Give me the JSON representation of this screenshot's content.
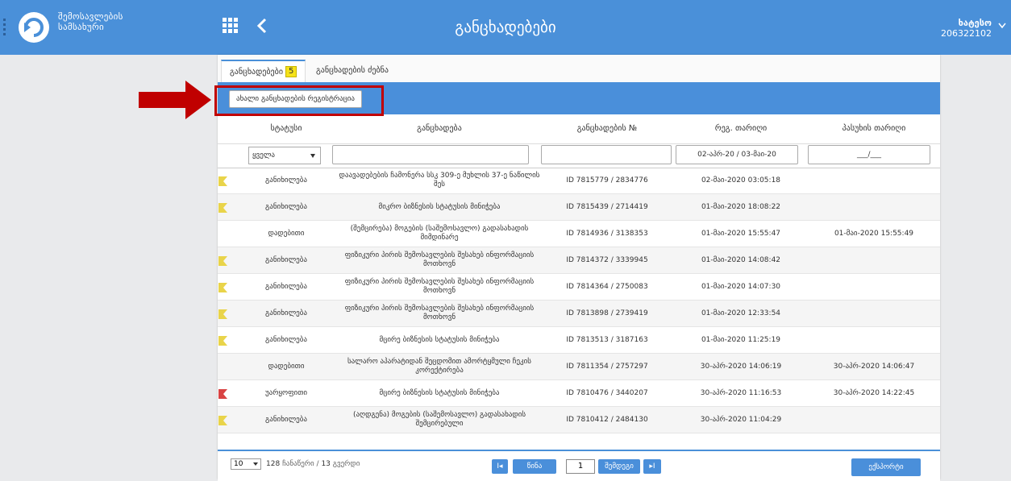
{
  "header": {
    "org_line1": "შემოსავლების",
    "org_line2": "სამსახური",
    "title": "განცხადებები",
    "user_name": "ხატესო",
    "user_id": "206322102"
  },
  "tabs": [
    {
      "label": "განცხადებები",
      "badge": "5"
    },
    {
      "label": "განცხადების ძებნა"
    }
  ],
  "toolbar": {
    "new_button": "ახალი განცხადების რეგისტრაცია"
  },
  "columns": [
    "სტატუსი",
    "განცხადება",
    "განცხადების №",
    "რეგ. თარიღი",
    "პასუხის თარიღი"
  ],
  "filters": {
    "status_value": "ყველა",
    "date_range": "02-აპრ-20 / 03-მაი-20",
    "answer_date": "___/___"
  },
  "rows": [
    {
      "flag": "yellow",
      "status": "განიხილება",
      "app": "დაავადებების ჩამონერა სსკ 309-ე მუხლის 37-ე ნაწილის შეს",
      "no": "ID 7815779 / 2834776",
      "reg": "02-მაი-2020 03:05:18",
      "ans": ""
    },
    {
      "flag": "yellow",
      "status": "განიხილება",
      "app": "მიკრო ბიზნესის სტატუსის მინიჭება",
      "no": "ID 7815439 / 2714419",
      "reg": "01-მაი-2020 18:08:22",
      "ans": ""
    },
    {
      "flag": "",
      "status": "დადებითი",
      "app": "(შემცირება) მოგების (საშემოსავლო) გადასახადის მიმდინარე",
      "no": "ID 7814936 / 3138353",
      "reg": "01-მაი-2020 15:55:47",
      "ans": "01-მაი-2020 15:55:49"
    },
    {
      "flag": "yellow",
      "status": "განიხილება",
      "app": "ფიზიკური პირის შემოსავლების შესახებ ინფორმაციის მოთხოვნ",
      "no": "ID 7814372 / 3339945",
      "reg": "01-მაი-2020 14:08:42",
      "ans": ""
    },
    {
      "flag": "yellow",
      "status": "განიხილება",
      "app": "ფიზიკური პირის შემოსავლების შესახებ ინფორმაციის მოთხოვნ",
      "no": "ID 7814364 / 2750083",
      "reg": "01-მაი-2020 14:07:30",
      "ans": ""
    },
    {
      "flag": "yellow",
      "status": "განიხილება",
      "app": "ფიზიკური პირის შემოსავლების შესახებ ინფორმაციის მოთხოვნ",
      "no": "ID 7813898 / 2739419",
      "reg": "01-მაი-2020 12:33:54",
      "ans": ""
    },
    {
      "flag": "yellow",
      "status": "განიხილება",
      "app": "მცირე ბიზნესის სტატუსის მინიჭება",
      "no": "ID 7813513 / 3187163",
      "reg": "01-მაი-2020 11:25:19",
      "ans": ""
    },
    {
      "flag": "",
      "status": "დადებითი",
      "app": "სალარო აპარატიდან შეცდომით ამორტყმული ჩეკის კორექტირება",
      "no": "ID 7811354 / 2757297",
      "reg": "30-აპრ-2020 14:06:19",
      "ans": "30-აპრ-2020 14:06:47"
    },
    {
      "flag": "red",
      "status": "უარყოფითი",
      "app": "მცირე ბიზნესის სტატუსის მინიჭება",
      "no": "ID 7810476 / 3440207",
      "reg": "30-აპრ-2020 11:16:53",
      "ans": "30-აპრ-2020 14:22:45"
    },
    {
      "flag": "yellow",
      "status": "განიხილება",
      "app": "(აღდგენა) მოგების (საშემოსავლო) გადასახადის შემცირებული",
      "no": "ID 7810412 / 2484130",
      "reg": "30-აპრ-2020 11:04:29",
      "ans": ""
    }
  ],
  "footer": {
    "page_size": "10",
    "records": "128",
    "records_label": "ჩანაწერი /",
    "pages": "13",
    "pages_label": "გვერდი",
    "first": "I◂",
    "prev": "წინა",
    "page": "1",
    "next": "შემდეგი",
    "last": "▸I",
    "export": "ექსპორტი"
  },
  "colors": {
    "accent": "#4a90d9",
    "flag_yellow": "#e9d44a",
    "flag_red": "#d94444",
    "highlight": "#c00000"
  }
}
